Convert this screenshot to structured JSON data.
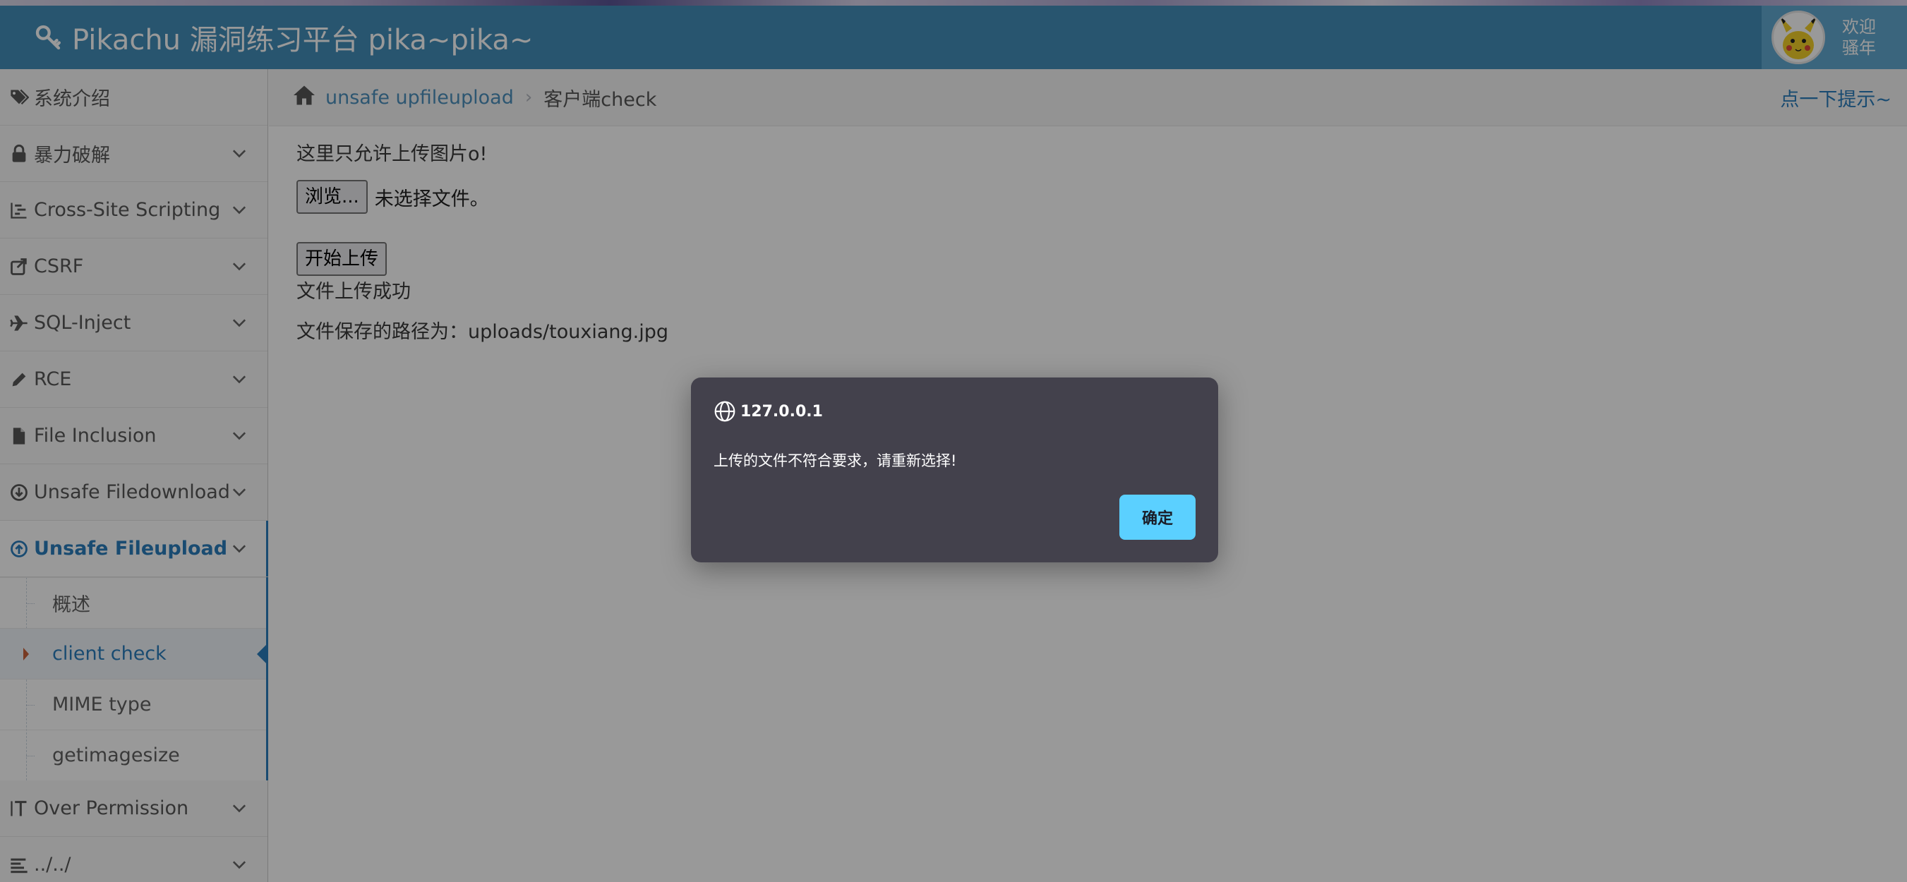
{
  "colors": {
    "navbar": "#438eb9",
    "accent": "#2b7dbc",
    "dialog_bg": "#43414c",
    "dialog_button": "#5bd0ff"
  },
  "header": {
    "title": "Pikachu 漏洞练习平台 pika~pika~",
    "icon": "key-icon",
    "user_welcome": "欢迎\n骚年"
  },
  "sidebar": {
    "items": [
      {
        "label": "系统介绍",
        "icon": "tags-icon"
      },
      {
        "label": "暴力破解",
        "icon": "lock-icon"
      },
      {
        "label": "Cross-Site Scripting",
        "icon": "list-icon"
      },
      {
        "label": "CSRF",
        "icon": "share-icon"
      },
      {
        "label": "SQL-Inject",
        "icon": "plane-icon"
      },
      {
        "label": "RCE",
        "icon": "pencil-icon"
      },
      {
        "label": "File Inclusion",
        "icon": "file-icon"
      },
      {
        "label": "Unsafe Filedownload",
        "icon": "download-icon"
      },
      {
        "label": "Unsafe Fileupload",
        "icon": "upload-icon"
      },
      {
        "label": "Over Permission",
        "icon": "text-height-icon"
      },
      {
        "label": "../../",
        "icon": "align-left-icon"
      }
    ],
    "sub_items": [
      "概述",
      "client check",
      "MIME type",
      "getimagesize"
    ]
  },
  "breadcrumb": {
    "link": "unsafe upfileupload",
    "current": "客户端check",
    "hint": "点一下提示~"
  },
  "content": {
    "intro": "这里只允许上传图片o!",
    "browse_label": "浏览...",
    "file_status": "未选择文件。",
    "upload_label": "开始上传",
    "success": "文件上传成功",
    "path": "文件保存的路径为：uploads/touxiang.jpg"
  },
  "dialog": {
    "origin": "127.0.0.1",
    "message": "上传的文件不符合要求，请重新选择!",
    "ok_label": "确定"
  }
}
